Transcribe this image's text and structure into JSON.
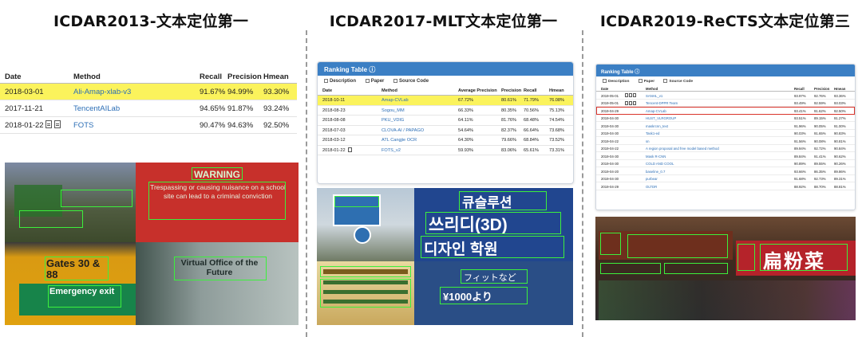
{
  "panels": [
    {
      "title": "ICDAR2013-文本定位第一",
      "table": {
        "columns": [
          "Date",
          "Method",
          "Recall",
          "Precision",
          "Hmean"
        ],
        "rows": [
          {
            "date": "2018-03-01",
            "method": "Ali-Amap-xlab-v3",
            "recall": "91.67%",
            "precision": "94.99%",
            "hmean": "93.30%",
            "highlighted": true
          },
          {
            "date": "2017-11-21",
            "method": "TencentAILab",
            "recall": "94.65%",
            "precision": "91.87%",
            "hmean": "93.24%"
          },
          {
            "date": "2018-01-22",
            "method": "FOTS",
            "recall": "90.47%",
            "precision": "94.63%",
            "hmean": "92.50%"
          }
        ]
      }
    },
    {
      "title": "ICDAR2017-MLT文本定位第一",
      "table": {
        "header_title": "Ranking Table",
        "tabs": [
          "Description",
          "Paper",
          "Source Code"
        ],
        "columns": [
          "Date",
          "Method",
          "Average Precision",
          "Precision",
          "Recall",
          "Hmean"
        ],
        "rows": [
          {
            "date": "2018-10-11",
            "method": "Amap-CVLab",
            "avg": "67.72%",
            "precision": "80.61%",
            "recall": "71.79%",
            "hmean": "76.08%",
            "highlighted": true
          },
          {
            "date": "2018-08-23",
            "method": "Sogou_MM",
            "avg": "66.33%",
            "precision": "80.35%",
            "recall": "70.56%",
            "hmean": "75.13%"
          },
          {
            "date": "2018-08-08",
            "method": "PKU_VDIG",
            "avg": "64.11%",
            "precision": "81.76%",
            "recall": "68.48%",
            "hmean": "74.54%"
          },
          {
            "date": "2018-07-03",
            "method": "CLOVA-AI / PAPAGO",
            "avg": "54.64%",
            "precision": "82.37%",
            "recall": "66.64%",
            "hmean": "73.68%"
          },
          {
            "date": "2018-03-12",
            "method": "ATL Cangjie OCR",
            "avg": "64.30%",
            "precision": "79.66%",
            "recall": "68.84%",
            "hmean": "73.52%"
          },
          {
            "date": "2018-01-22",
            "method": "FOTS_v2",
            "avg": "59.93%",
            "precision": "83.06%",
            "recall": "65.61%",
            "hmean": "73.31%"
          }
        ]
      }
    },
    {
      "title": "ICDAR2019-ReCTS文本定位第三",
      "table": {
        "header_title": "Ranking Table",
        "tabs": [
          "Description",
          "Paper",
          "Source Code"
        ],
        "columns": [
          "Date",
          "Method",
          "Recall",
          "Precision",
          "Hmean"
        ],
        "rows": [
          {
            "date": "2019-05-01",
            "method": "SANHL_v1",
            "recall": "93.97%",
            "precision": "92.76%",
            "hmean": "93.36%"
          },
          {
            "date": "2019-05-01",
            "method": "Tencent-DPPR Team",
            "recall": "93.49%",
            "precision": "92.59%",
            "hmean": "93.03%"
          },
          {
            "date": "2019-04-29",
            "method": "Amap-CVLab",
            "recall": "93.41%",
            "precision": "91.62%",
            "hmean": "92.50%",
            "highlighted": true
          },
          {
            "date": "2019-04-30",
            "method": "HUST_VLRGROUP",
            "recall": "93.51%",
            "precision": "89.15%",
            "hmean": "91.27%"
          },
          {
            "date": "2019-04-30",
            "method": "maskrcnn_text",
            "recall": "91.96%",
            "precision": "90.05%",
            "hmean": "91.00%"
          },
          {
            "date": "2019-04-30",
            "method": "Task1-ed",
            "recall": "90.03%",
            "precision": "91.65%",
            "hmean": "90.83%"
          },
          {
            "date": "2019-04-22",
            "method": "sn",
            "recall": "91.56%",
            "precision": "90.08%",
            "hmean": "90.81%"
          },
          {
            "date": "2019-04-22",
            "method": "A region proposal and free model based method",
            "recall": "89.94%",
            "precision": "92.72%",
            "hmean": "90.84%"
          },
          {
            "date": "2019-04-30",
            "method": "Mask R-CNN",
            "recall": "89.84%",
            "precision": "91.41%",
            "hmean": "90.62%"
          },
          {
            "date": "2019-04-30",
            "method": "COLD AND COOL",
            "recall": "90.89%",
            "precision": "89.55%",
            "hmean": "90.26%"
          },
          {
            "date": "2019-04-20",
            "method": "baseline_0.7",
            "recall": "93.66%",
            "precision": "86.35%",
            "hmean": "89.86%"
          },
          {
            "date": "2019-04-30",
            "method": "purbear",
            "recall": "91.68%",
            "precision": "92.73%",
            "hmean": "89.31%"
          },
          {
            "date": "2019-04-29",
            "method": "OLTDR",
            "recall": "88.92%",
            "precision": "88.70%",
            "hmean": "88.81%"
          }
        ]
      }
    }
  ],
  "photo_text": {
    "p1_sign1": "WARNING",
    "p1_sign1_body": "Trespassing or causing nuisance on a school site can lead to a criminal conviction",
    "p1_sign2": "Gates 30 & 88",
    "p1_sign2b": "Emergency exit",
    "p1_sign3": "Virtual Office of the Future",
    "p2_sign1": "큐슬루션",
    "p2_sign2": "쓰리디(3D)",
    "p2_sign3": "디자인 학원",
    "p2_sign4": "フィットなど",
    "p2_sign5": "¥1000より",
    "p3_sign1": "扁粉菜"
  },
  "colors": {
    "highlight": "#fbf35c",
    "link": "#2c6eb6",
    "card_header": "#3b7fc4",
    "detection_box": "#3cf03c",
    "rank_outline": "#d9342b"
  }
}
